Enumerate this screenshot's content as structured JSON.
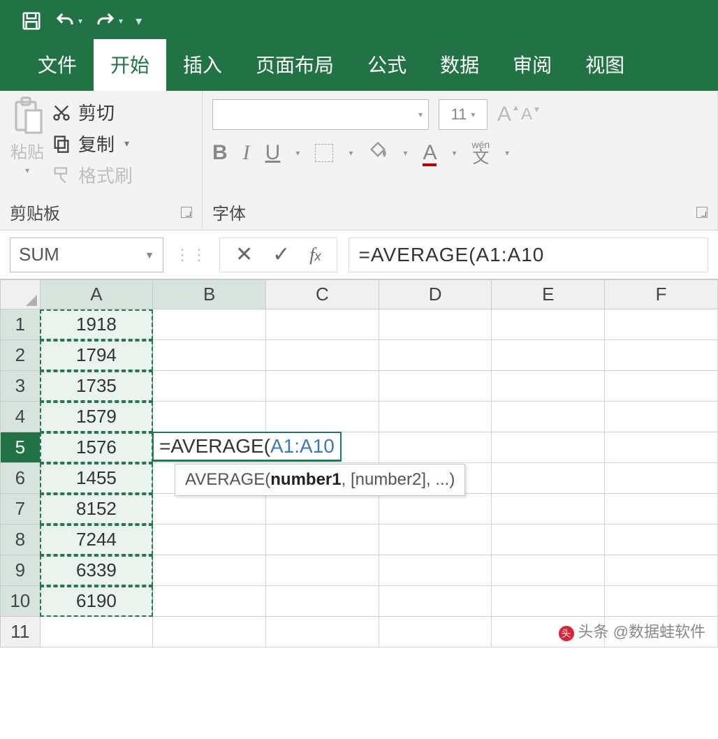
{
  "qat": {
    "save": "save-icon",
    "undo": "undo-icon",
    "redo": "redo-icon"
  },
  "tabs": {
    "file": "文件",
    "home": "开始",
    "insert": "插入",
    "pagelayout": "页面布局",
    "formulas": "公式",
    "data": "数据",
    "review": "审阅",
    "view": "视图"
  },
  "clipboard": {
    "paste": "粘贴",
    "cut": "剪切",
    "copy": "复制",
    "format_painter": "格式刷",
    "group_label": "剪贴板"
  },
  "font": {
    "size": "11",
    "group_label": "字体",
    "bold": "B",
    "italic": "I",
    "underline": "U",
    "grow": "A",
    "shrink": "A",
    "wen_top": "wén",
    "wen_bottom": "文",
    "color_a": "A"
  },
  "fx": {
    "namebox": "SUM",
    "formula": "=AVERAGE(A1:A10"
  },
  "columns": [
    "A",
    "B",
    "C",
    "D",
    "E",
    "F"
  ],
  "rows": [
    "1",
    "2",
    "3",
    "4",
    "5",
    "6",
    "7",
    "8",
    "9",
    "10",
    "11"
  ],
  "cells": {
    "A": [
      "1918",
      "1794",
      "1735",
      "1579",
      "1576",
      "1455",
      "8152",
      "7244",
      "6339",
      "6190",
      ""
    ]
  },
  "active_cell": {
    "prefix": "=AVERAGE(",
    "ref": "A1:A10"
  },
  "tooltip": {
    "fn": "AVERAGE(",
    "arg1": "number1",
    "rest": ", [number2], ...)"
  },
  "watermark": "头条 @数据蛙软件"
}
